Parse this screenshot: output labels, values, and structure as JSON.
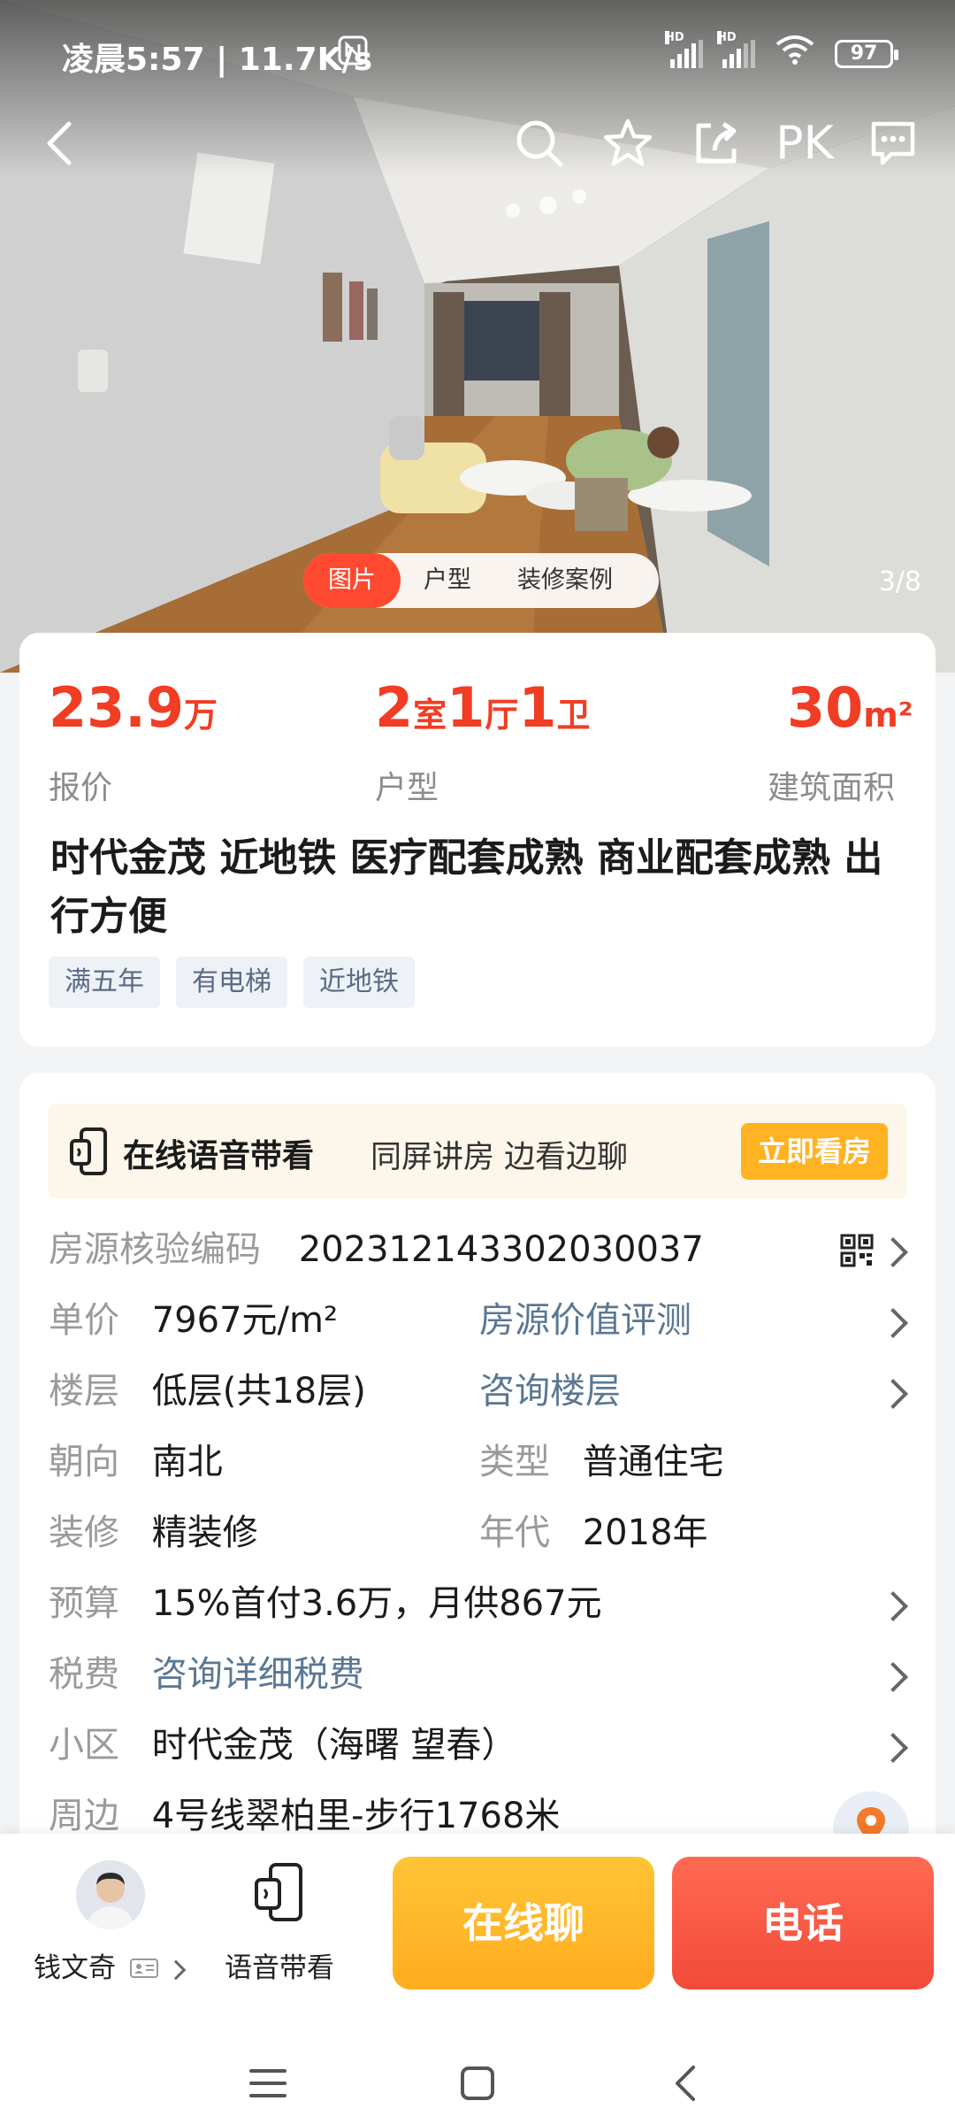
{
  "status_bar": {
    "time_speed": "凌晨5:57 | 11.7K/s",
    "network_type_1": "HD",
    "network_type_2": "HD",
    "battery": "97",
    "icons": [
      "nfc-icon",
      "signal-icon",
      "signal-icon",
      "wifi-icon",
      "battery-icon"
    ]
  },
  "top_nav": {
    "pk_label": "PK",
    "icons": [
      "back-icon",
      "search-icon",
      "star-icon",
      "share-icon",
      "message-icon"
    ]
  },
  "photo": {
    "tabs": [
      "图片",
      "户型",
      "装修案例"
    ],
    "active_tab": 0,
    "counter": "3/8"
  },
  "summary": {
    "price": {
      "value": "23.9",
      "unit": "万",
      "label": "报价"
    },
    "layout": {
      "rooms": "2",
      "rooms_unit": "室",
      "halls": "1",
      "halls_unit": "厅",
      "baths": "1",
      "baths_unit": "卫",
      "label": "户型"
    },
    "area": {
      "value": "30",
      "unit": "m²",
      "label": "建筑面积"
    },
    "title": "时代金茂 近地铁 医疗配套成熟 商业配套成熟 出行方便",
    "tags": [
      "满五年",
      "有电梯",
      "近地铁"
    ]
  },
  "banner": {
    "title": "在线语音带看",
    "subtitle": "同屏讲房 边看边聊",
    "button": "立即看房"
  },
  "details": {
    "code_label": "房源核验编码",
    "code_value": "202312143302030037",
    "unit_price_label": "单价",
    "unit_price_value": "7967元/m²",
    "value_eval_link": "房源价值评测",
    "floor_label": "楼层",
    "floor_value": "低层(共18层)",
    "floor_link": "咨询楼层",
    "orientation_label": "朝向",
    "orientation_value": "南北",
    "type_label": "类型",
    "type_value": "普通住宅",
    "decoration_label": "装修",
    "decoration_value": "精装修",
    "year_label": "年代",
    "year_value": "2018年",
    "budget_label": "预算",
    "budget_value": "15%首付3.6万，月供867元",
    "tax_label": "税费",
    "tax_link": "咨询详细税费",
    "community_label": "小区",
    "community_value": "时代金茂（海曙 望春）",
    "nearby_label": "周边",
    "nearby_value": "4号线翠柏里-步行1768米"
  },
  "bottom_bar": {
    "agent_name": "钱文奇",
    "voice_label": "语音带看",
    "chat_button": "在线聊",
    "call_button": "电话"
  },
  "colors": {
    "accent_red": "#f03d24",
    "link_blue": "#5a7793",
    "chat_yellow": "#ffb222",
    "call_red": "#f24a3a"
  }
}
